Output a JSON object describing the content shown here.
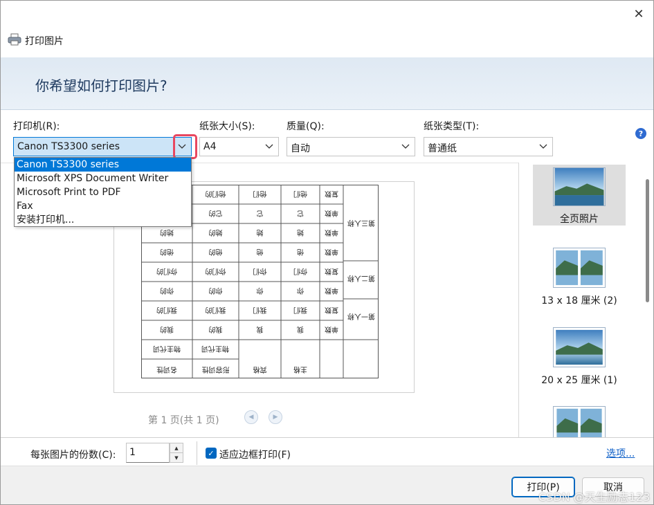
{
  "window": {
    "title": "打印图片",
    "close_glyph": "✕"
  },
  "header": {
    "question": "你希望如何打印图片?"
  },
  "settings": {
    "printer_label": "打印机(R):",
    "printer_value": "Canon TS3300 series",
    "paper_size_label": "纸张大小(S):",
    "paper_size_value": "A4",
    "quality_label": "质量(Q):",
    "quality_value": "自动",
    "paper_type_label": "纸张类型(T):",
    "paper_type_value": "普通纸",
    "help_glyph": "?"
  },
  "printer_options": [
    "Canon TS3300 series",
    "Microsoft XPS Document Writer",
    "Microsoft Print to PDF",
    "Fax",
    "安装打印机..."
  ],
  "worksheet": {
    "bottom_row": [
      "名词性",
      "形容词性",
      "宾格",
      "主格"
    ],
    "bottom_header": "物主代词",
    "rows": [
      [
        "他们的",
        "他们的",
        "他们",
        "他们",
        "复数"
      ],
      [
        "它的",
        "它的",
        "它",
        "它",
        "单数"
      ],
      [
        "她的",
        "她的",
        "她",
        "她",
        "单数"
      ],
      [
        "他的",
        "他的",
        "他",
        "他",
        "单数"
      ],
      [
        "你们的",
        "你们的",
        "你们",
        "你们",
        "复数"
      ],
      [
        "你的",
        "你的",
        "你",
        "你",
        "单数"
      ],
      [
        "我们的",
        "我们的",
        "我们",
        "我们",
        "复数"
      ],
      [
        "我的",
        "我的",
        "我",
        "我",
        "单数"
      ]
    ],
    "persons": [
      "第三人称",
      "第二人称",
      "第一人称"
    ]
  },
  "pager": {
    "text": "第 1 页(共 1 页)",
    "prev_glyph": "◀",
    "next_glyph": "▶"
  },
  "layouts": [
    {
      "caption": "全页照片"
    },
    {
      "caption": "13 x 18 厘米 (2)"
    },
    {
      "caption": "20 x 25 厘米 (1)"
    },
    {
      "caption": ""
    }
  ],
  "copies": {
    "label": "每张图片的份数(C):",
    "value": "1"
  },
  "fit_to_frame": {
    "label": "适应边框打印(F)",
    "checked": true
  },
  "options_link": "选项...",
  "buttons": {
    "print": "打印(P)",
    "cancel": "取消"
  },
  "watermark": "CSDN @天生励志123"
}
